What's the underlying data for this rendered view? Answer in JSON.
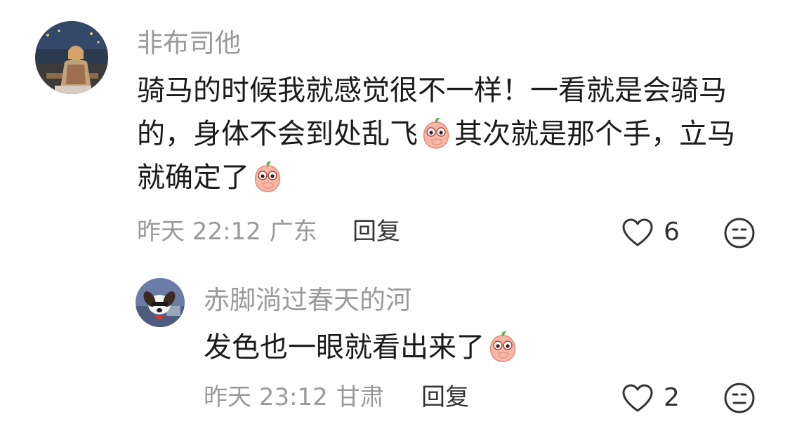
{
  "comment": {
    "username": "非布司他",
    "text_1": "骑马的时候我就感觉很不一样！一看就是会骑马的，身体不会到处乱飞",
    "text_2": "其次就是那个手，立马就确定了",
    "time": "昨天 22:12",
    "location": "广东",
    "reply_label": "回复",
    "likes": "6",
    "reply": {
      "username": "赤脚淌过春天的河",
      "text": "发色也一眼就看出来了",
      "time": "昨天 23:12",
      "location": "甘肃",
      "reply_label": "回复",
      "likes": "2"
    }
  },
  "icons": {
    "like": "heart-outline-icon",
    "emoji_reaction": "neutral-face-icon",
    "inline_emoji": "peach-giggle-emoji"
  }
}
